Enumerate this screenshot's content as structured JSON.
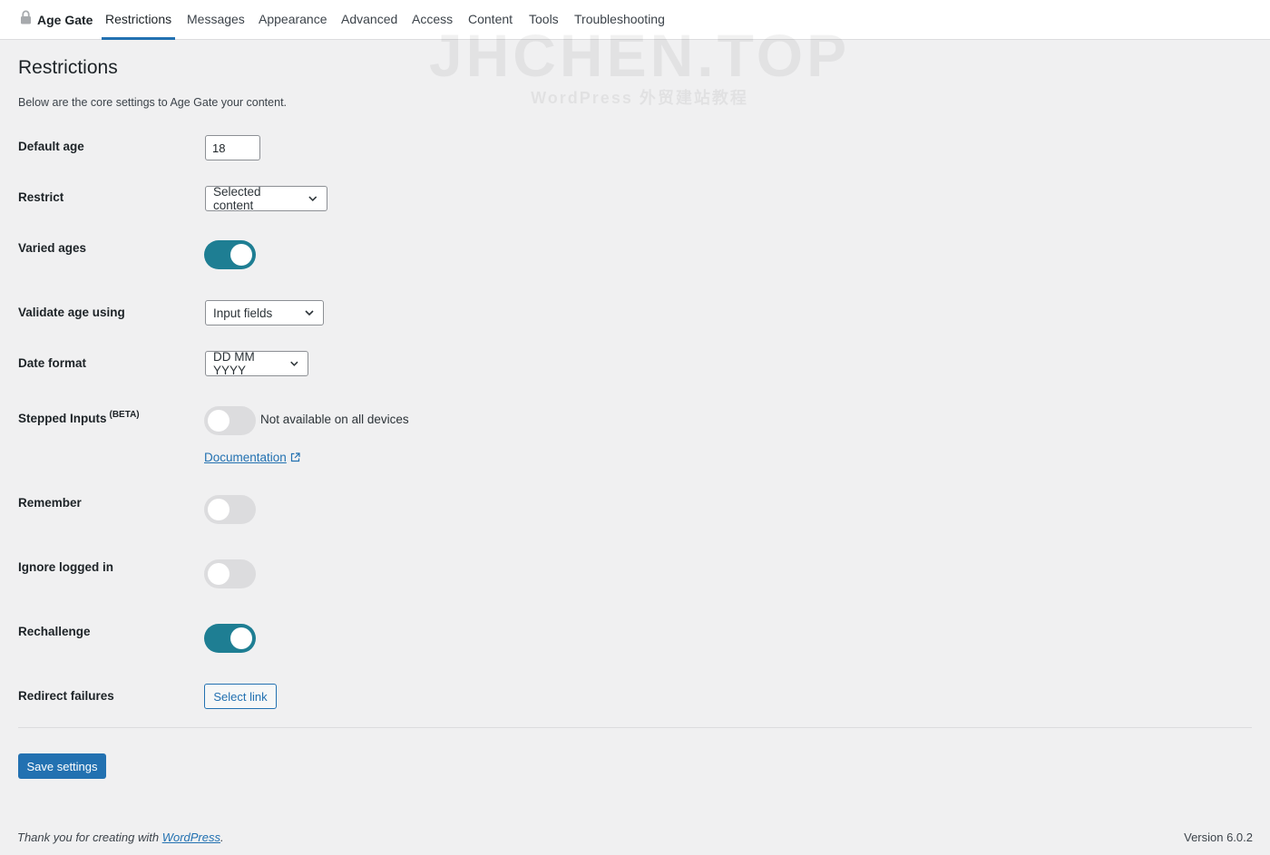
{
  "nav": {
    "brand": "Age Gate",
    "tabs": [
      {
        "label": "Restrictions"
      },
      {
        "label": "Messages"
      },
      {
        "label": "Appearance"
      },
      {
        "label": "Advanced"
      },
      {
        "label": "Access"
      },
      {
        "label": "Content"
      },
      {
        "label": "Tools"
      },
      {
        "label": "Troubleshooting"
      }
    ],
    "active_tab": "Restrictions"
  },
  "watermark": {
    "main": "JHCHEN.TOP",
    "sub": "WordPress 外贸建站教程"
  },
  "page": {
    "title": "Restrictions",
    "intro": "Below are the core settings to Age Gate your content."
  },
  "settings": {
    "default_age": {
      "label": "Default age",
      "value": "18"
    },
    "restrict": {
      "label": "Restrict",
      "value": "Selected content"
    },
    "varied_ages": {
      "label": "Varied ages",
      "enabled": true
    },
    "validate_age": {
      "label": "Validate age using",
      "value": "Input fields"
    },
    "date_format": {
      "label": "Date format",
      "value": "DD MM YYYY"
    },
    "stepped_inputs": {
      "label": "Stepped Inputs",
      "badge": "(BETA)",
      "enabled": false,
      "note": "Not available on all devices",
      "doc_link": "Documentation"
    },
    "remember": {
      "label": "Remember",
      "enabled": false
    },
    "ignore_logged_in": {
      "label": "Ignore logged in",
      "enabled": false
    },
    "rechallenge": {
      "label": "Rechallenge",
      "enabled": true
    },
    "redirect_failures": {
      "label": "Redirect failures",
      "button": "Select link"
    }
  },
  "actions": {
    "save": "Save settings"
  },
  "footer": {
    "thanks_prefix": "Thank you for creating with ",
    "thanks_link": "WordPress",
    "thanks_suffix": ".",
    "version": "Version 6.0.2"
  },
  "colors": {
    "accent": "#2271b1",
    "toggle_on": "#1e7e93",
    "toggle_off": "#dcdcde",
    "background": "#f0f0f1"
  },
  "icons": {
    "brand": "lock-icon",
    "select": "chevron-down-icon",
    "doc": "external-link-icon"
  }
}
